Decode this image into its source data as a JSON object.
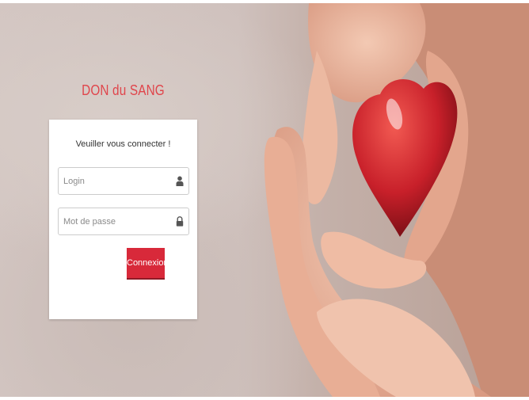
{
  "app": {
    "title": "DON du SANG"
  },
  "login_form": {
    "heading": "Veuiller vous connecter !",
    "login_placeholder": "Login",
    "password_placeholder": "Mot de passe",
    "submit_label": "Connexion",
    "login_icon": "user-icon",
    "password_icon": "lock-icon"
  },
  "colors": {
    "brand": "#e0454b",
    "button": "#d8293a",
    "heart": "#c8202a"
  },
  "background": {
    "image": "hands-holding-red-heart"
  }
}
